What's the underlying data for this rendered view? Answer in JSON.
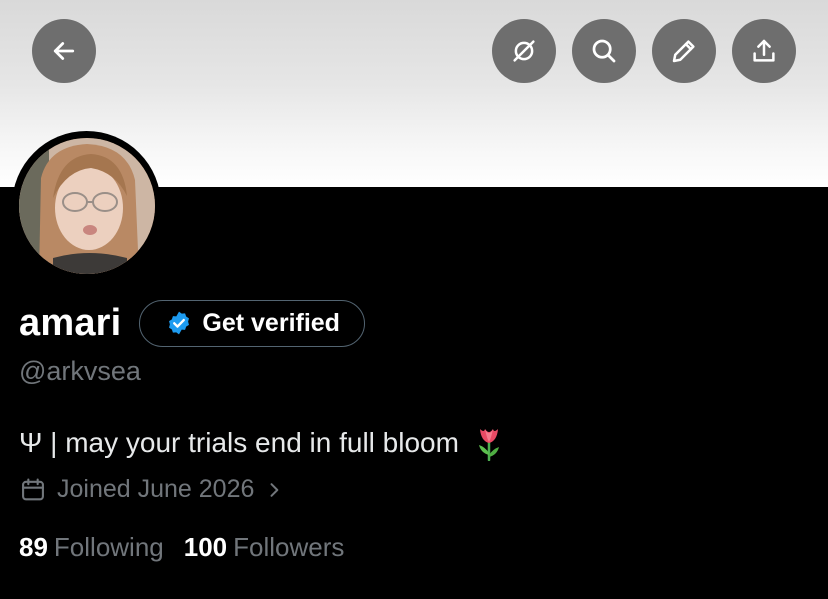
{
  "header": {
    "back_icon": "arrow-left-icon",
    "actions": [
      "translate-icon",
      "search-icon",
      "edit-icon",
      "share-icon"
    ]
  },
  "profile": {
    "display_name": "amari",
    "verify_label": "Get verified",
    "handle": "@arkvsea",
    "bio": "Ψ | may your trials end in full bloom",
    "bio_emoji": "tulip-emoji",
    "joined": "Joined June 2026",
    "following_count": "89",
    "following_label": "Following",
    "followers_count": "100",
    "followers_label": "Followers"
  },
  "colors": {
    "background": "#000000",
    "button_bg": "#6e6e6e",
    "muted_text": "#71767b",
    "verified_blue": "#1d9bf0",
    "pill_border": "#536471"
  }
}
